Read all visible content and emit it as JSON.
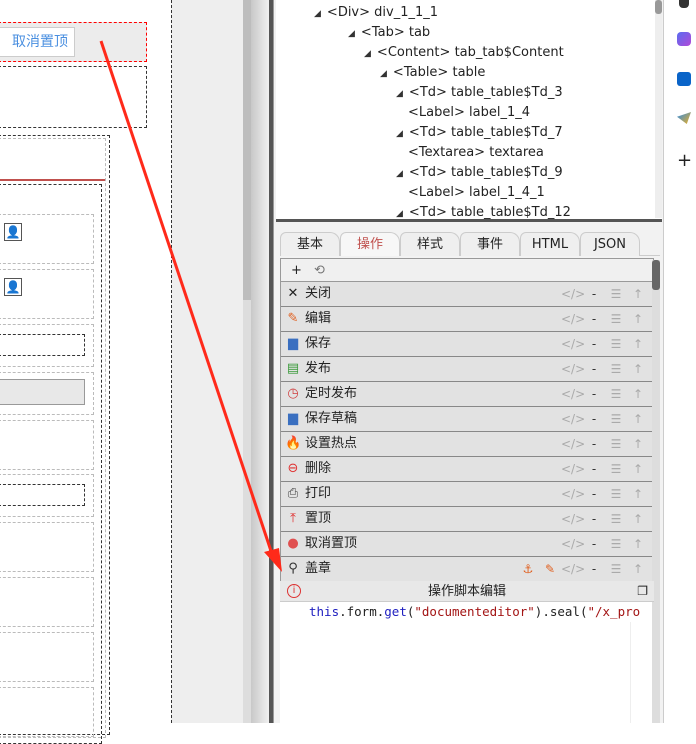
{
  "canvas": {
    "button_label": "取消置顶"
  },
  "tree": [
    {
      "tag": "<Div>",
      "name": "div_1_1_1"
    },
    {
      "tag": "<Tab>",
      "name": "tab"
    },
    {
      "tag": "<Content>",
      "name": "tab_tab$Content"
    },
    {
      "tag": "<Table>",
      "name": "table"
    },
    {
      "tag": "<Td>",
      "name": "table_table$Td_3"
    },
    {
      "tag": "<Label>",
      "name": "label_1_4"
    },
    {
      "tag": "<Td>",
      "name": "table_table$Td_7"
    },
    {
      "tag": "<Textarea>",
      "name": "textarea"
    },
    {
      "tag": "<Td>",
      "name": "table_table$Td_9"
    },
    {
      "tag": "<Label>",
      "name": "label_1_4_1"
    },
    {
      "tag": "<Td>",
      "name": "table_table$Td_12"
    }
  ],
  "tabs": [
    "基本",
    "操作",
    "样式",
    "事件",
    "HTML",
    "JSON"
  ],
  "toolbar": {
    "add": "+",
    "reset": "⟲"
  },
  "actions": [
    {
      "label": "关闭",
      "icon": "close-icon"
    },
    {
      "label": "编辑",
      "icon": "pencil-icon"
    },
    {
      "label": "保存",
      "icon": "save-icon"
    },
    {
      "label": "发布",
      "icon": "publish-icon"
    },
    {
      "label": "定时发布",
      "icon": "timed-publish-icon"
    },
    {
      "label": "保存草稿",
      "icon": "save-draft-icon"
    },
    {
      "label": "设置热点",
      "icon": "hotspot-icon"
    },
    {
      "label": "删除",
      "icon": "delete-icon"
    },
    {
      "label": "打印",
      "icon": "print-icon"
    },
    {
      "label": "置顶",
      "icon": "pin-top-icon"
    },
    {
      "label": "取消置顶",
      "icon": "unpin-icon"
    },
    {
      "label": "盖章",
      "icon": "seal-icon"
    }
  ],
  "row_ops": {
    "code": "</>",
    "minus": "-",
    "list": "☰",
    "up": "↑"
  },
  "editor": {
    "title": "操作脚本编辑",
    "code_this": "this",
    "code_1": ".form.",
    "code_get": "get",
    "code_2": "(",
    "code_str": "\"documenteditor\"",
    "code_3": ").seal(",
    "code_str2": "\"/x_pro"
  },
  "colors": {
    "accent": "#c0504d",
    "arrow": "#ff2a1a"
  }
}
